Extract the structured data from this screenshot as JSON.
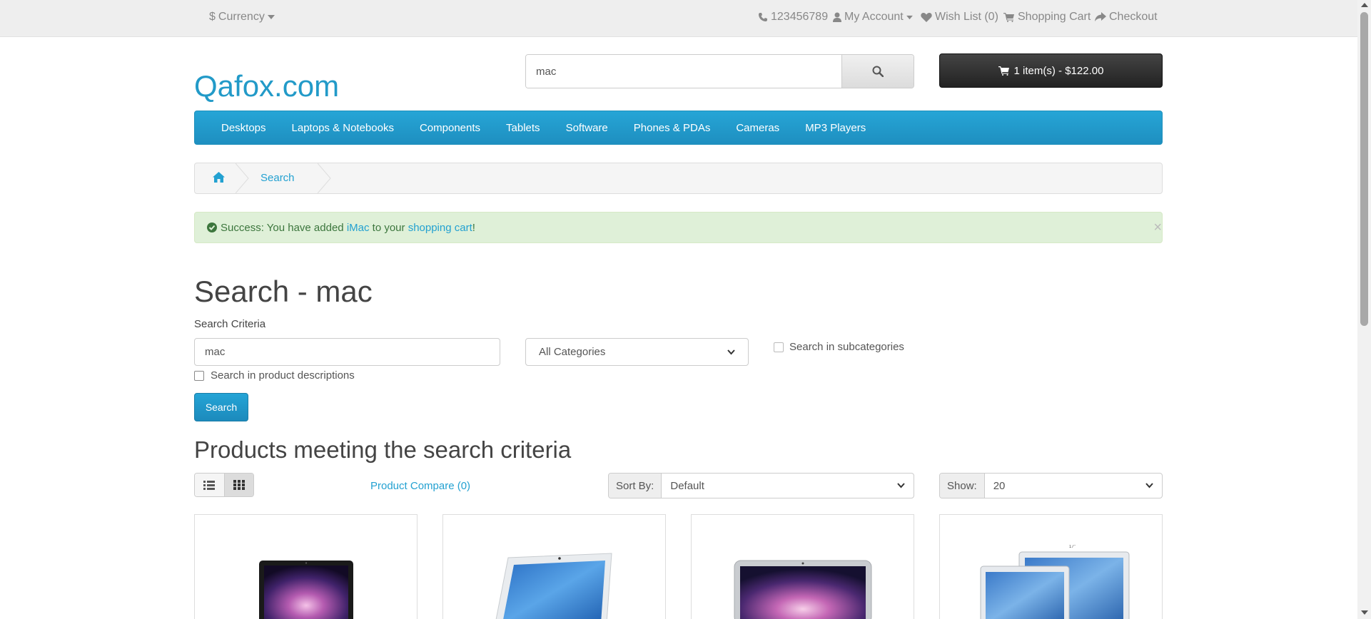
{
  "topbar": {
    "currency_label": "Currency",
    "phone": "123456789",
    "my_account": "My Account",
    "wish_list": "Wish List (0)",
    "shopping_cart": "Shopping Cart",
    "checkout": "Checkout"
  },
  "header": {
    "logo": "Qafox.com",
    "search_value": "mac",
    "cart_button": "1 item(s) - $122.00"
  },
  "menu": {
    "items": [
      {
        "label": "Desktops"
      },
      {
        "label": "Laptops & Notebooks"
      },
      {
        "label": "Components"
      },
      {
        "label": "Tablets"
      },
      {
        "label": "Software"
      },
      {
        "label": "Phones & PDAs"
      },
      {
        "label": "Cameras"
      },
      {
        "label": "MP3 Players"
      }
    ]
  },
  "breadcrumb": {
    "current": "Search"
  },
  "alert": {
    "prefix": "Success: You have added ",
    "product_link": "iMac",
    "middle": " to your ",
    "cart_link": "shopping cart",
    "suffix": "!",
    "close": "×"
  },
  "search_page": {
    "title": "Search - mac",
    "criteria_label": "Search Criteria",
    "criteria_value": "mac",
    "category_selected": "All Categories",
    "subcategories_label": "Search in subcategories",
    "descriptions_label": "Search in product descriptions",
    "search_button": "Search"
  },
  "results": {
    "heading": "Products meeting the search criteria",
    "compare_link": "Product Compare (0)",
    "sort_label": "Sort By:",
    "sort_value": "Default",
    "show_label": "Show:",
    "show_value": "20"
  },
  "colors": {
    "brand": "#229ac8",
    "menu_bg": "#229ac8",
    "alert_bg": "#dff0d8",
    "cart_bg": "#303030"
  }
}
